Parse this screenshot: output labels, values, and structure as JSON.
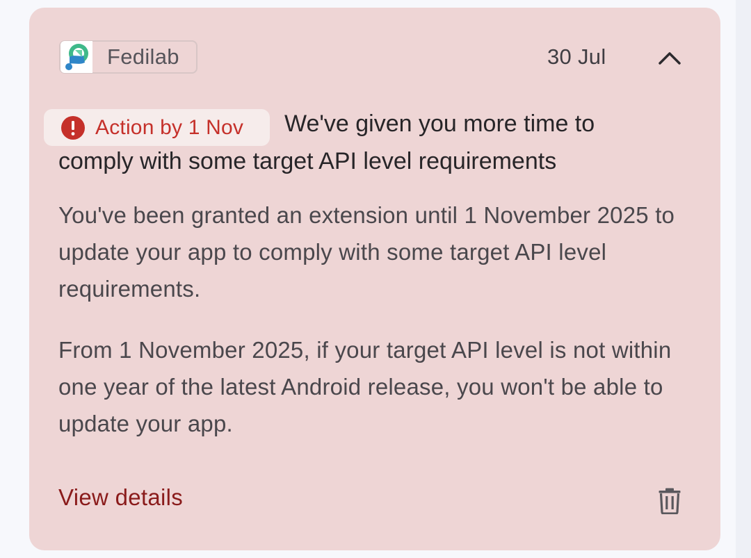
{
  "notification": {
    "app_name": "Fedilab",
    "app_icon": "fedilab-logo-icon",
    "date": "30 Jul",
    "collapse_icon": "chevron-up-icon",
    "badge": {
      "icon": "error-circle-icon",
      "label": "Action by 1 Nov",
      "color": "#c5302a"
    },
    "title_line1": "We've given you more time to",
    "title_line2": "comply with some target API level requirements",
    "body_paragraph1": "You've been granted an extension until 1 November 2025 to update your app to comply with some target API level requirements.",
    "body_paragraph2": "From 1 November 2025, if your target API level is not within one year of the latest Android release, you won't be able to update your app.",
    "view_details_label": "View details",
    "view_details_color": "#8a1b1b",
    "delete_icon": "trash-icon",
    "card_background": "#eed5d5"
  }
}
